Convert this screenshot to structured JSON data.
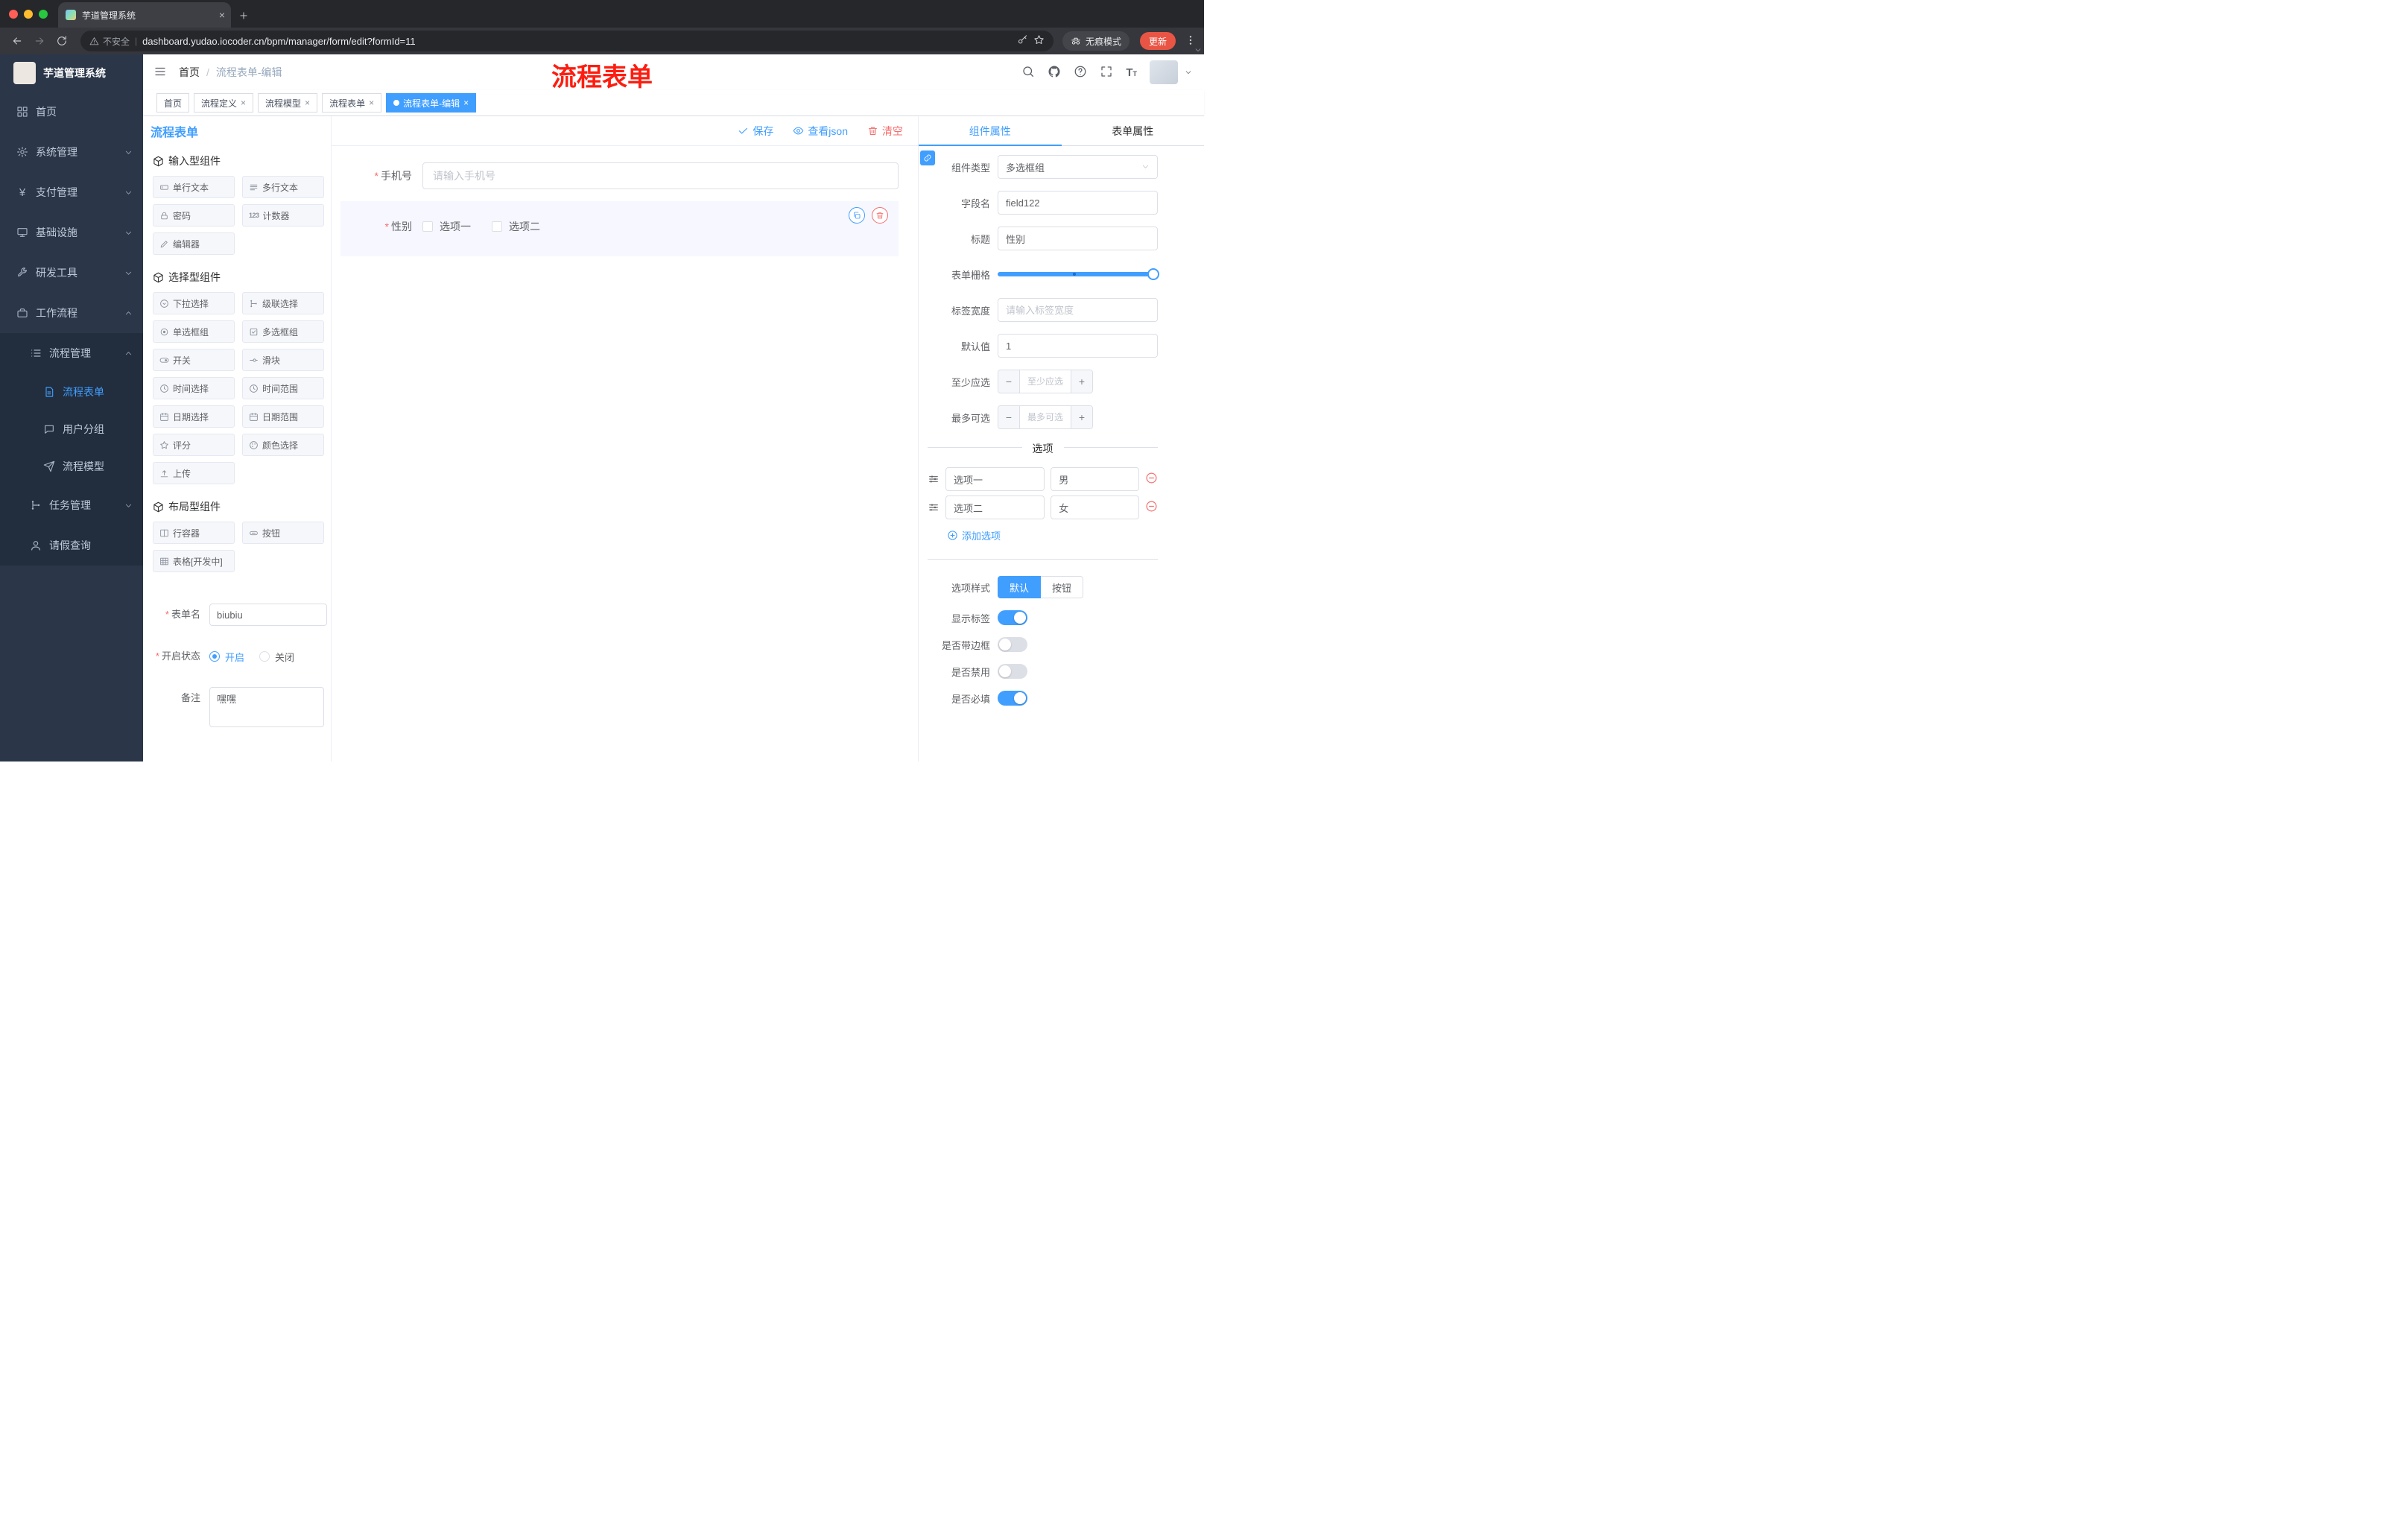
{
  "glyphs": {
    "close": "×",
    "plus": "+",
    "minus": "−",
    "kebab": "⋮",
    "pipe": "|",
    "slash": "/",
    "asterisk": "*",
    "yen": "¥",
    "counter": "123",
    "font_big": "T",
    "font_small": "T"
  },
  "browser": {
    "tab_title": "芋道管理系统",
    "not_secure": "不安全",
    "url": "dashboard.yudao.iocoder.cn/bpm/manager/form/edit?formId=11",
    "incognito": "无痕模式",
    "update": "更新"
  },
  "annotation": {
    "text": "流程表单",
    "color": "#fd1d10"
  },
  "sidebar": {
    "title": "芋道管理系统",
    "top": [
      "首页",
      "系统管理",
      "支付管理",
      "基础设施",
      "研发工具",
      "工作流程"
    ],
    "group": {
      "title": "流程管理",
      "items": [
        "流程表单",
        "用户分组",
        "流程模型"
      ]
    },
    "tail": [
      "任务管理",
      "请假查询"
    ]
  },
  "header": {
    "breadcrumb_home": "首页",
    "breadcrumb_current": "流程表单-编辑"
  },
  "tags": [
    "首页",
    "流程定义",
    "流程模型",
    "流程表单",
    "流程表单-编辑"
  ],
  "designer": {
    "panel_title": "流程表单",
    "save": "保存",
    "view_json": "查看json",
    "clear": "清空",
    "groups": [
      {
        "title": "输入型组件",
        "items": [
          "单行文本",
          "多行文本",
          "密码",
          "计数器",
          "编辑器"
        ]
      },
      {
        "title": "选择型组件",
        "items": [
          "下拉选择",
          "级联选择",
          "单选框组",
          "多选框组",
          "开关",
          "滑块",
          "时间选择",
          "时间范围",
          "日期选择",
          "日期范围",
          "评分",
          "颜色选择",
          "上传"
        ]
      },
      {
        "title": "布局型组件",
        "items": [
          "行容器",
          "按钮",
          "表格[开发中]"
        ]
      }
    ],
    "meta": {
      "name_label": "表单名",
      "name_value": "biubiu",
      "status_label": "开启状态",
      "status_on": "开启",
      "status_off": "关闭",
      "remark_label": "备注",
      "remark_value": "嘿嘿"
    }
  },
  "canvas": {
    "phone_label": "手机号",
    "phone_placeholder": "请输入手机号",
    "gender_label": "性别",
    "gender_options": [
      "选项一",
      "选项二"
    ]
  },
  "props": {
    "tab_component": "组件属性",
    "tab_form": "表单属性",
    "type_label": "组件类型",
    "type_value": "多选框组",
    "field_label": "字段名",
    "field_value": "field122",
    "title_label": "标题",
    "title_value": "性别",
    "grid_label": "表单栅格",
    "width_label": "标签宽度",
    "width_placeholder": "请输入标签宽度",
    "default_label": "默认值",
    "default_value": "1",
    "min_label": "至少应选",
    "min_placeholder": "至少应选",
    "max_label": "最多可选",
    "max_placeholder": "最多可选",
    "options_title": "选项",
    "options": [
      {
        "label": "选项一",
        "value": "男"
      },
      {
        "label": "选项二",
        "value": "女"
      }
    ],
    "add_option": "添加选项",
    "style_label": "选项样式",
    "style_options": [
      "默认",
      "按钮"
    ],
    "switches": [
      {
        "label": "显示标签",
        "on": true
      },
      {
        "label": "是否带边框",
        "on": false
      },
      {
        "label": "是否禁用",
        "on": false
      },
      {
        "label": "是否必填",
        "on": true
      }
    ]
  },
  "colors": {
    "primary": "#409EFF",
    "danger": "#F56C6C",
    "sidebar": "#2b3649",
    "annotation": "#fd1d10"
  }
}
